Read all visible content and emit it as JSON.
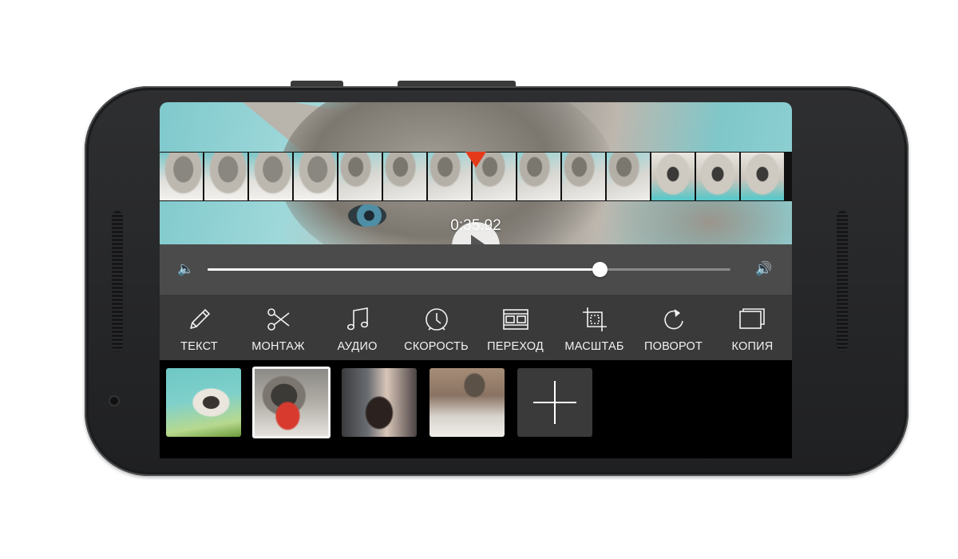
{
  "player": {
    "timecode": "0:35.92",
    "volume_level_percent": 75
  },
  "toolbar": {
    "tools": [
      {
        "id": "text",
        "label": "ТЕКСТ",
        "icon": "pencil-icon"
      },
      {
        "id": "montage",
        "label": "МОНТАЖ",
        "icon": "scissors-icon"
      },
      {
        "id": "audio",
        "label": "АУДИО",
        "icon": "music-note-icon"
      },
      {
        "id": "speed",
        "label": "СКОРОСТЬ",
        "icon": "stopwatch-icon"
      },
      {
        "id": "transition",
        "label": "ПЕРЕХОД",
        "icon": "film-frames-icon"
      },
      {
        "id": "scale",
        "label": "МАСШТАБ",
        "icon": "crop-icon"
      },
      {
        "id": "rotate",
        "label": "ПОВОРОТ",
        "icon": "rotate-icon"
      },
      {
        "id": "copy",
        "label": "КОПИЯ",
        "icon": "copy-icon"
      }
    ]
  },
  "clips": {
    "count": 4,
    "selected_index": 1,
    "add_icon": "plus-icon"
  },
  "colors": {
    "playhead": "#e53a1a",
    "toolbar_bg": "#3a3a3a",
    "volume_bg": "#4b4b4b",
    "tray_bg": "#000000"
  }
}
